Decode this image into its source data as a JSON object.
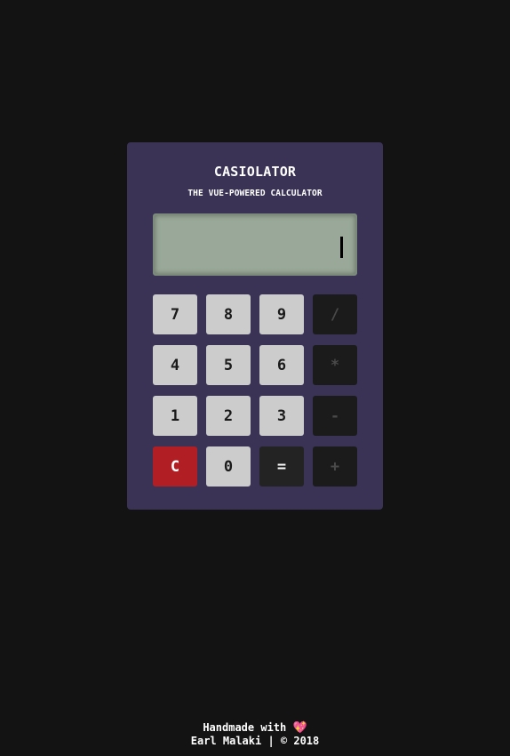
{
  "calculator": {
    "title": "CASIOLATOR",
    "subtitle": "THE VUE-POWERED CALCULATOR",
    "display": {
      "value": ""
    },
    "keys": {
      "k7": "7",
      "k8": "8",
      "k9": "9",
      "div": "/",
      "k4": "4",
      "k5": "5",
      "k6": "6",
      "mul": "*",
      "k1": "1",
      "k2": "2",
      "k3": "3",
      "sub": "-",
      "clear": "C",
      "k0": "0",
      "eq": "=",
      "add": "+"
    }
  },
  "footer": {
    "line1": "Handmade with",
    "heart_icon": "heart-icon",
    "line2": "Earl Malaki | © 2018"
  },
  "colors": {
    "background": "#131313",
    "calculator": "#3a3356",
    "display": "#99a898",
    "number_key": "#cccccc",
    "operator_key": "#1b1b1b",
    "clear_key": "#b11f25"
  }
}
